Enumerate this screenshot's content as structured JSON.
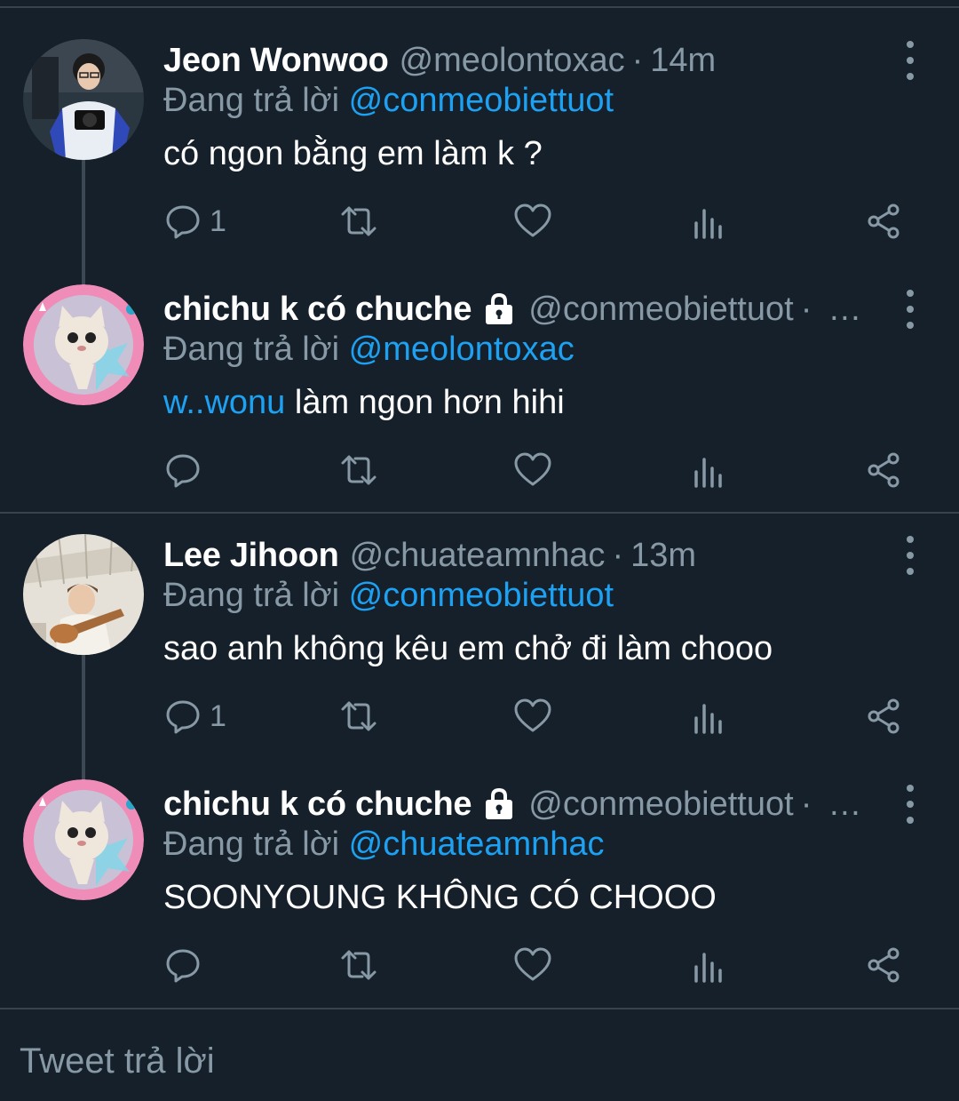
{
  "threads": [
    {
      "tweets": [
        {
          "name": "Jeon Wonwoo",
          "locked": false,
          "handle": "@meolontoxac",
          "time": "14m",
          "truncated": false,
          "replying_prefix": "Đang trả lời",
          "replying_to": "@conmeobiettuot",
          "body_mention": "",
          "body": "có ngon bằng em làm k ?",
          "reply_count": "1",
          "avatar": "man-with-camera-photo"
        },
        {
          "name": "chichu k có chuche",
          "locked": true,
          "handle": "@conmeobiettuot",
          "time": "",
          "truncated": true,
          "ellipsis": "…",
          "replying_prefix": "Đang trả lời",
          "replying_to": "@meolontoxac",
          "body_mention": "w..wonu",
          "body": " làm ngon hơn hihi",
          "reply_count": "",
          "avatar": "cat-with-pink-frame"
        }
      ]
    },
    {
      "tweets": [
        {
          "name": "Lee Jihoon",
          "locked": false,
          "handle": "@chuateamnhac",
          "time": "13m",
          "truncated": false,
          "replying_prefix": "Đang trả lời",
          "replying_to": "@conmeobiettuot",
          "body_mention": "",
          "body": "sao anh không kêu em chở đi làm chooo",
          "reply_count": "1",
          "avatar": "man-with-guitar-photo"
        },
        {
          "name": "chichu k có chuche",
          "locked": true,
          "handle": "@conmeobiettuot",
          "time": "",
          "truncated": true,
          "ellipsis": "…",
          "replying_prefix": "Đang trả lời",
          "replying_to": "@chuateamnhac",
          "body_mention": "",
          "body": "SOONYOUNG KHÔNG CÓ CHOOO",
          "reply_count": "",
          "avatar": "cat-with-pink-frame"
        }
      ]
    }
  ],
  "composer": {
    "placeholder": "Tweet trả lời"
  },
  "icons": {
    "reply": "reply-icon",
    "retweet": "retweet-icon",
    "like": "heart-icon",
    "analytics": "analytics-icon",
    "share": "share-icon",
    "lock": "lock-icon",
    "more": "more-vertical-icon"
  },
  "colors": {
    "background": "#15202b",
    "text": "#ffffff",
    "muted": "#8899a6",
    "accent": "#1da1f2",
    "divider": "#38444d"
  }
}
